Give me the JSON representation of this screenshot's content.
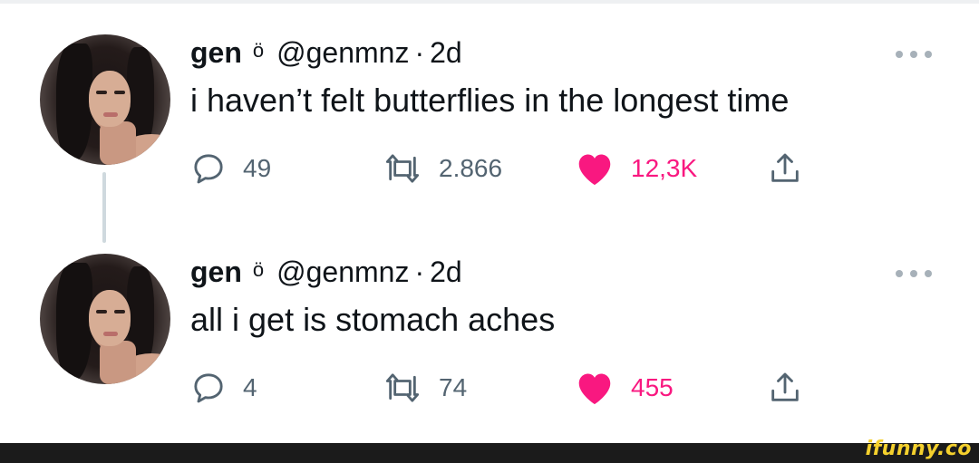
{
  "tweets": [
    {
      "name": "gen",
      "emoji": "ö",
      "handle": "@genmnz",
      "separator": "·",
      "time": "2d",
      "text": "i haven’t felt butterflies in the longest time",
      "replies": "49",
      "retweets": "2.866",
      "likes": "12,3K",
      "liked": true
    },
    {
      "name": "gen",
      "emoji": "ö",
      "handle": "@genmnz",
      "separator": "·",
      "time": "2d",
      "text": "all i get is stomach aches",
      "replies": "4",
      "retweets": "74",
      "likes": "455",
      "liked": true
    }
  ],
  "watermark": "ifunny.co",
  "colors": {
    "like": "#f91880",
    "muted": "#536471",
    "text": "#0f1419",
    "thread_line": "#cfd9de",
    "watermark": "#f4d02d"
  },
  "icons": [
    "reply-icon",
    "retweet-icon",
    "heart-icon",
    "share-icon",
    "more-icon"
  ]
}
